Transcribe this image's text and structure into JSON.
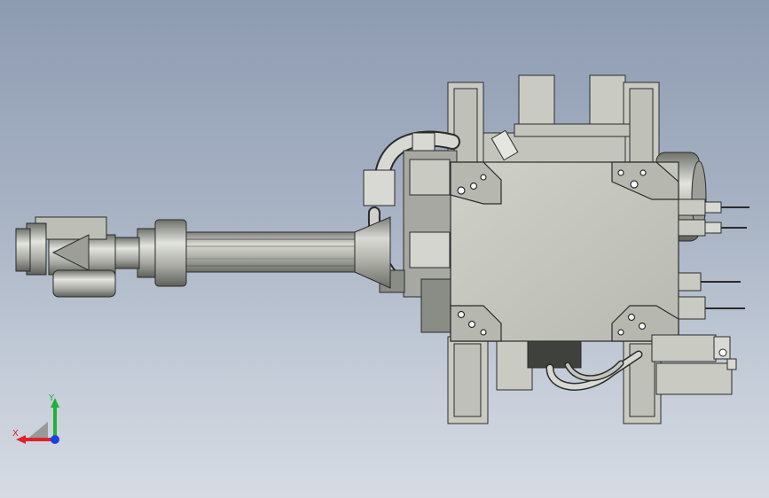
{
  "viewport": {
    "background_top": "#8d9bb1",
    "background_bottom": "#d6dbe3"
  },
  "model": {
    "part_color": "#c9cbc3",
    "edge_color": "#2b2b2b",
    "shadow_color": "#8e9089"
  },
  "triad": {
    "x_label": "X",
    "y_label": "Y",
    "x_color": "#e0202a",
    "y_color": "#1fb23a",
    "z_color": "#1d3fe0"
  }
}
